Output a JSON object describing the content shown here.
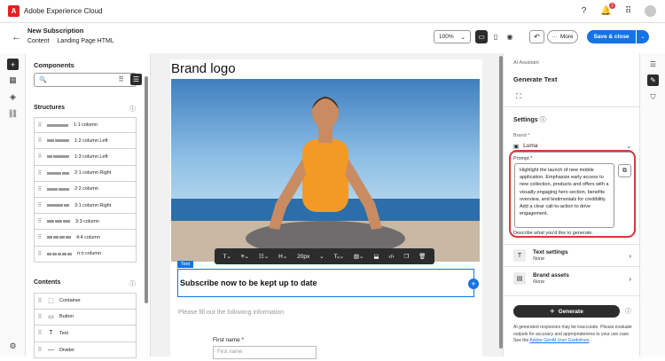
{
  "app": {
    "name": "Adobe Experience Cloud",
    "logo_letter": "A",
    "notification_count": "2"
  },
  "header": {
    "title": "New Subscription",
    "breadcrumbs": [
      "Content",
      "Landing Page HTML"
    ]
  },
  "toolbar": {
    "zoom": "100%",
    "more_label": "More",
    "save_label": "Save & close"
  },
  "components": {
    "title": "Components",
    "search_placeholder": "",
    "structures_label": "Structures",
    "structures": [
      {
        "label": "1:1 column",
        "bars": [
          1
        ]
      },
      {
        "label": "1:2 column Left",
        "bars": [
          1,
          2
        ]
      },
      {
        "label": "1:3 column Left",
        "bars": [
          1,
          3
        ]
      },
      {
        "label": "2:1 column Right",
        "bars": [
          2,
          1
        ]
      },
      {
        "label": "2:2 column",
        "bars": [
          1,
          1
        ]
      },
      {
        "label": "3:1 column Right",
        "bars": [
          3,
          1
        ]
      },
      {
        "label": "3:3 column",
        "bars": [
          1,
          1,
          1
        ]
      },
      {
        "label": "4:4 column",
        "bars": [
          1,
          1,
          1,
          1
        ]
      },
      {
        "label": "n:n column",
        "bars": [
          1,
          1,
          1,
          1,
          1
        ]
      }
    ],
    "contents_label": "Contents",
    "contents": [
      {
        "label": "Container",
        "icon": "container-icon",
        "glyph": "⬚"
      },
      {
        "label": "Button",
        "icon": "button-icon",
        "glyph": "▭"
      },
      {
        "label": "Text",
        "icon": "text-icon",
        "glyph": "T"
      },
      {
        "label": "Divider",
        "icon": "divider-icon",
        "glyph": "—"
      }
    ]
  },
  "canvas": {
    "brand_logo": "Brand logo",
    "text_label": "Text",
    "font_size": "20px",
    "headline": "Subscribe now to be kept up to date",
    "subtext": "Please fill out the following information",
    "first_name_label": "First name",
    "first_name_required": "*",
    "first_name_placeholder": "First name"
  },
  "ai": {
    "section": "AI Assistant",
    "title": "Generate Text",
    "settings_label": "Settings",
    "brand_label": "Brand",
    "brand_required": "*",
    "brand_value": "Luma",
    "prompt_label": "Prompt",
    "prompt_required": "*",
    "prompt_text": "Highlight the launch of new mobile application. Emphasize early access to new collection, products and offers with a visually engaging hero section, benefits overview, and testimonials for credibility. Add a clear call-to-action to drive engagement.",
    "prompt_help": "Describe what you'd like to generate.",
    "text_settings_label": "Text settings",
    "text_settings_value": "None",
    "brand_assets_label": "Brand assets",
    "brand_assets_value": "None",
    "generate_label": "Generate",
    "disclaimer": "AI generated responses may be inaccurate. Please evaluate outputs for accuracy and appropriateness to your use case. See the",
    "disclaimer_link": "Adobe GenAI User Guidelines",
    "disclaimer_end": "."
  },
  "colors": {
    "accent": "#1473e6",
    "alert": "#d7373f",
    "dark": "#2c2c2c"
  }
}
